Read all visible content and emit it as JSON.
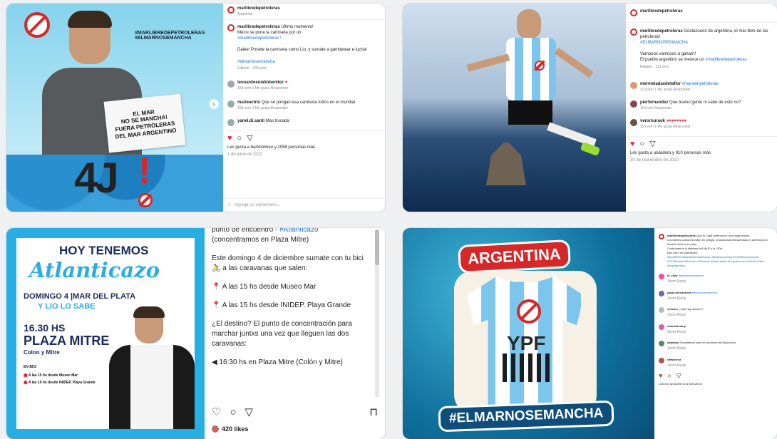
{
  "c1": {
    "hashtag_banner": "#MARLIBREDEPETROLERAS\n#ELMARNOSEMANCHA",
    "sign_text": "EL MAR\nNO SE MANCHA!\nFUERA PETROLERAS\nDEL MAR ARGENTINO",
    "date_art": "4J",
    "account_top": "marlibredepetroleras",
    "account_sub": "Argentina",
    "post_user": "marlibredepetroleras",
    "post_l1": "Ultimo momento!",
    "post_l2": "Messi se pone la camiseta por un",
    "post_tag": "#marlibredepetroleras !",
    "post_l3": "Dalee! Ponete la camiseta como Lio, y sumate a gambetear e luchal",
    "post_tag2": "#elmarnosemancha",
    "edited": "Editado · 158 sem",
    "c1_user": "leonardoeulaliobenitez",
    "c1_meta": "158 sem  1 Me gusta  Responder",
    "c2_user": "marleactrix",
    "c2_text": "Que se pongan esa camiseta todos en el mundial",
    "c2_meta": "158 sem  1 Me gusta  Responder",
    "c3_user": "yanel.di.santi",
    "c3_text": "Mas trucada",
    "likes": "Les gusta a bartololmeu y 2058 personas más",
    "date": "1 de junio de 2022",
    "add_comment": "Agrega un comentario..."
  },
  "c2": {
    "account": "marlibredepetroleras",
    "post_user": "marlibredepetroleras",
    "post_l1": "Goolazoooo de argentina, el mar libre de las petroleras!",
    "post_tag": "#ELMARNOSEMANCHA",
    "post_l2": "Vamooos vamooos a ganarr!!",
    "post_l3": "El pueblo argentino se merece un",
    "post_tag2": "#marlibredepetroleras",
    "edited": "Editado · 113 sem",
    "c1_user": "mermeladasdetaflor",
    "c1_text": "#marseinpetroleras",
    "c1_meta": "113 sem  1 Me gusta  Responder",
    "c2_user": "pierfernandez",
    "c2_text": "Que bueno gente ni sabe de esto no?",
    "c2_meta": "113 sem  Responder",
    "c3_user": "verorouraok",
    "c3_meta": "113 sem  1 Me gusta  Responder",
    "likes": "Les gusta a ululadora y 910 personas más",
    "date": "30 de noviembre de 2022"
  },
  "c3": {
    "headline": "HOY TENEMOS",
    "script": "Atlanticazo",
    "l1": "DOMINGO 4 |MAR DEL PLATA",
    "l2": "Y LIO LO SABE",
    "l3": "16.30 HS",
    "l4": "PLAZA MITRE",
    "l5": "Colon y Mitre",
    "l6": "EN BICI",
    "l7": "A las 15 hs desde Museo Mar",
    "l8": "A las 15 hs desde INIDEP, Playa Grande",
    "t0": "punto de encuentro -",
    "t0_tag": "#Atlanticazo",
    "t1": "(concentramos en Plaza Mitre)",
    "t2": "Este domingo 4 de diciembre sumate con tu bici 🚴 a las caravanas que salen:",
    "t3": "A las 15 hs desde Museo Mar",
    "t4": "A las 15 hs desde INIDEP. Playa Grande",
    "t5": "¿El destino? El punto de concentración para marchar juntxs una vez que lleguen las dos caravanas:",
    "t6": "16:30 hs en Plaza Mitre (Colón y Mitre)",
    "likes": "420 likes"
  },
  "c4": {
    "banner": "ARGENTINA",
    "shirt_text": "YPF",
    "hashtag": "#ELMARNOSEMANCHA",
    "post_user": "marlibredepetroleras",
    "post_text": "Que la Copa América no nos haga olvidar...",
    "line2": "Los bienes comunes están en peligro, la avanzada extractivista en américa con llevarse todo a su paso.",
    "line3": "Continuamos la defensa del MAR y la VIDA",
    "line4": "Mar Libre de petroleras!",
    "tags": "#NoAlRIGI #BastaDeExtractivismo #BasementClub #OutOfExpoSummit #ATTWhales #MarLibre #Seaside #Saberbalde #CopaAmerica #Messi #Dibu #soyargentino",
    "c1_user": "la_chaz",
    "c1_text": "#elmarnosemancha",
    "c2_user": "paula.bercarmora",
    "c2_text": "#elmarnosemancha",
    "c3_user": "checker",
    "c3_text": "¿Qué hay mirarez?",
    "c4_user": "charlashmary",
    "c5_user": "damiana",
    "c5_text": "Sudamerica sufre el síndrome de Estocolmo",
    "c6_user": "riffamerca",
    "likes": "Liked by anncbelle and 938 others",
    "meta": "2sem  Reply"
  },
  "colors": {
    "accent_red": "#d62828",
    "link": "#1f6fd1",
    "sky": "#6ec6e6"
  }
}
